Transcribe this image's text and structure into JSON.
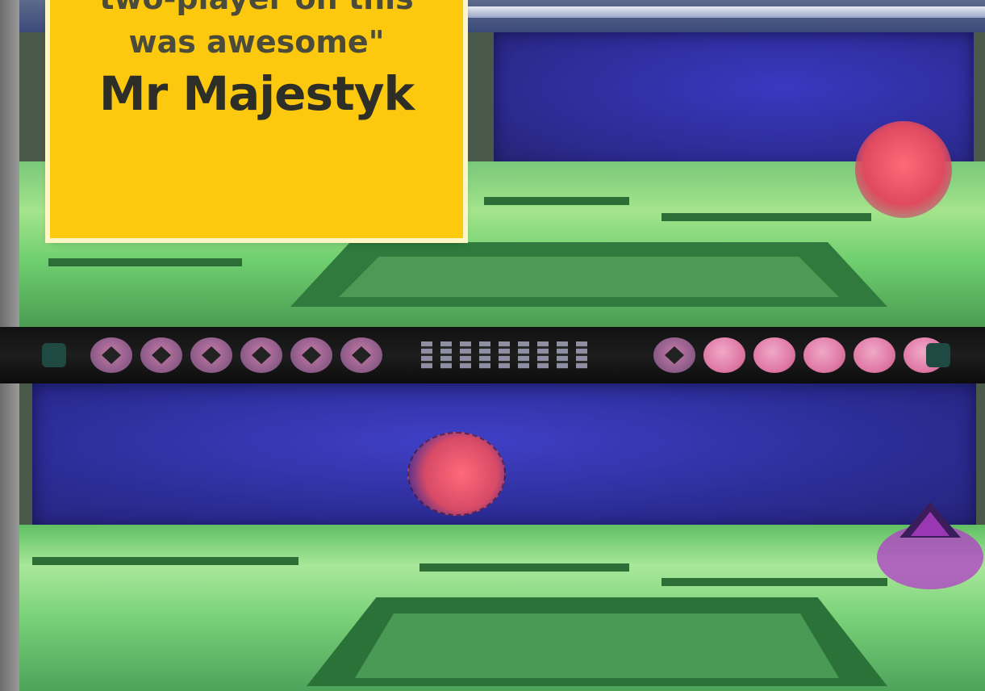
{
  "quote": {
    "line1": "two-player on this",
    "line2": "was awesome\"",
    "author": "Mr Majestyk"
  },
  "hud": {
    "player1_lives_total": 6,
    "player1_lives_filled": 0,
    "player2_lives_total": 6,
    "player2_lives_filled": 5,
    "score_glyph_count": 9
  },
  "colors": {
    "quote_box": "#fdc90e",
    "water": "#2c2c96",
    "grass": "#7ad27a",
    "ball": "#e04a60",
    "ship": "#b23cc8"
  },
  "sprites": [
    "ball-top",
    "ball-mid",
    "spaceship"
  ]
}
